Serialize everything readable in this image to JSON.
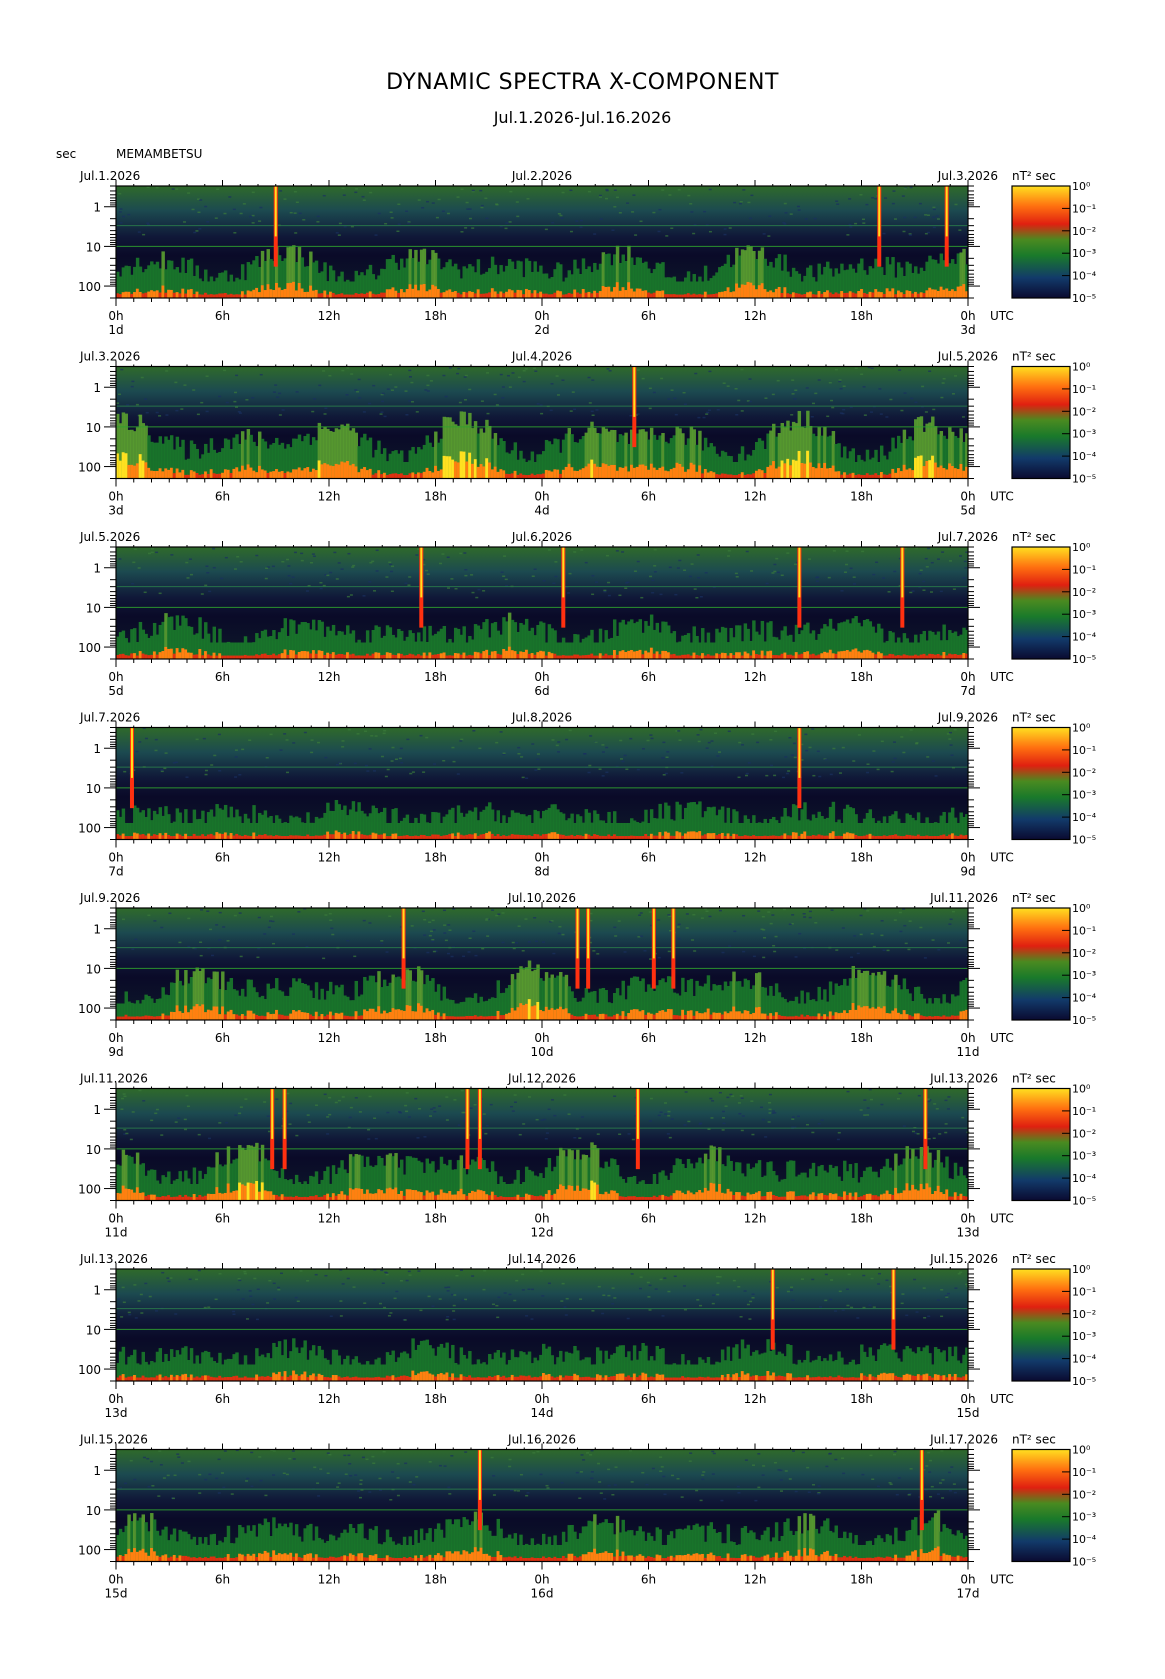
{
  "title": "DYNAMIC SPECTRA X-COMPONENT",
  "subtitle": "Jul.1.2026-Jul.16.2026",
  "y_unit": "sec",
  "station": "MEMAMBETSU",
  "time_zone": "UTC",
  "colorbar_unit": "nT² sec",
  "chart_data": {
    "type": "heatmap",
    "yaxis": {
      "label": "sec",
      "scale": "log",
      "range": [
        0.3,
        200
      ],
      "tick_labels": [
        "1",
        "10",
        "100"
      ]
    },
    "xaxis": {
      "tick_labels": [
        "0h",
        "6h",
        "12h",
        "18h",
        "0h",
        "6h",
        "12h",
        "18h",
        "0h"
      ]
    },
    "colorbar": {
      "label": "nT² sec",
      "scale": "log",
      "range": [
        1e-05,
        1
      ],
      "tick_labels": [
        "10⁰",
        "10⁻¹",
        "10⁻²",
        "10⁻³",
        "10⁻⁴",
        "10⁻⁵"
      ],
      "colors": [
        "#0a0a30",
        "#123a6a",
        "#1a7a2a",
        "#5aa030",
        "#e03010",
        "#ff8010",
        "#ffe020"
      ]
    },
    "panels": [
      {
        "start": "Jul.1.2026",
        "mid": "Jul.2.2026",
        "end": "Jul.3.2026",
        "day_labels": [
          "1d",
          "2d",
          "3d"
        ],
        "activity": 0.55,
        "spikes_h": [
          9.0,
          43.0,
          46.8
        ]
      },
      {
        "start": "Jul.3.2026",
        "mid": "Jul.4.2026",
        "end": "Jul.5.2026",
        "day_labels": [
          "3d",
          "4d",
          "5d"
        ],
        "activity": 0.75,
        "spikes_h": [
          29.2
        ]
      },
      {
        "start": "Jul.5.2026",
        "mid": "Jul.6.2026",
        "end": "Jul.7.2026",
        "day_labels": [
          "5d",
          "6d",
          "7d"
        ],
        "activity": 0.4,
        "spikes_h": [
          17.2,
          25.2,
          38.5,
          44.3
        ]
      },
      {
        "start": "Jul.7.2026",
        "mid": "Jul.8.2026",
        "end": "Jul.9.2026",
        "day_labels": [
          "7d",
          "8d",
          "9d"
        ],
        "activity": 0.3,
        "spikes_h": [
          0.9,
          38.5
        ]
      },
      {
        "start": "Jul.9.2026",
        "mid": "Jul.10.2026",
        "end": "Jul.11.2026",
        "day_labels": [
          "9d",
          "10d",
          "11d"
        ],
        "activity": 0.6,
        "spikes_h": [
          16.2,
          26.0,
          26.6,
          30.3,
          31.4
        ]
      },
      {
        "start": "Jul.11.2026",
        "mid": "Jul.12.2026",
        "end": "Jul.13.2026",
        "day_labels": [
          "11d",
          "12d",
          "13d"
        ],
        "activity": 0.6,
        "spikes_h": [
          8.8,
          9.5,
          19.8,
          20.5,
          29.4,
          45.6
        ]
      },
      {
        "start": "Jul.13.2026",
        "mid": "Jul.14.2026",
        "end": "Jul.15.2026",
        "day_labels": [
          "13d",
          "14d",
          "15d"
        ],
        "activity": 0.35,
        "spikes_h": [
          37.0,
          43.8
        ]
      },
      {
        "start": "Jul.15.2026",
        "mid": "Jul.16.2026",
        "end": "Jul.17.2026",
        "day_labels": [
          "15d",
          "16d",
          "17d"
        ],
        "activity": 0.45,
        "spikes_h": [
          20.5,
          45.4
        ]
      }
    ]
  }
}
